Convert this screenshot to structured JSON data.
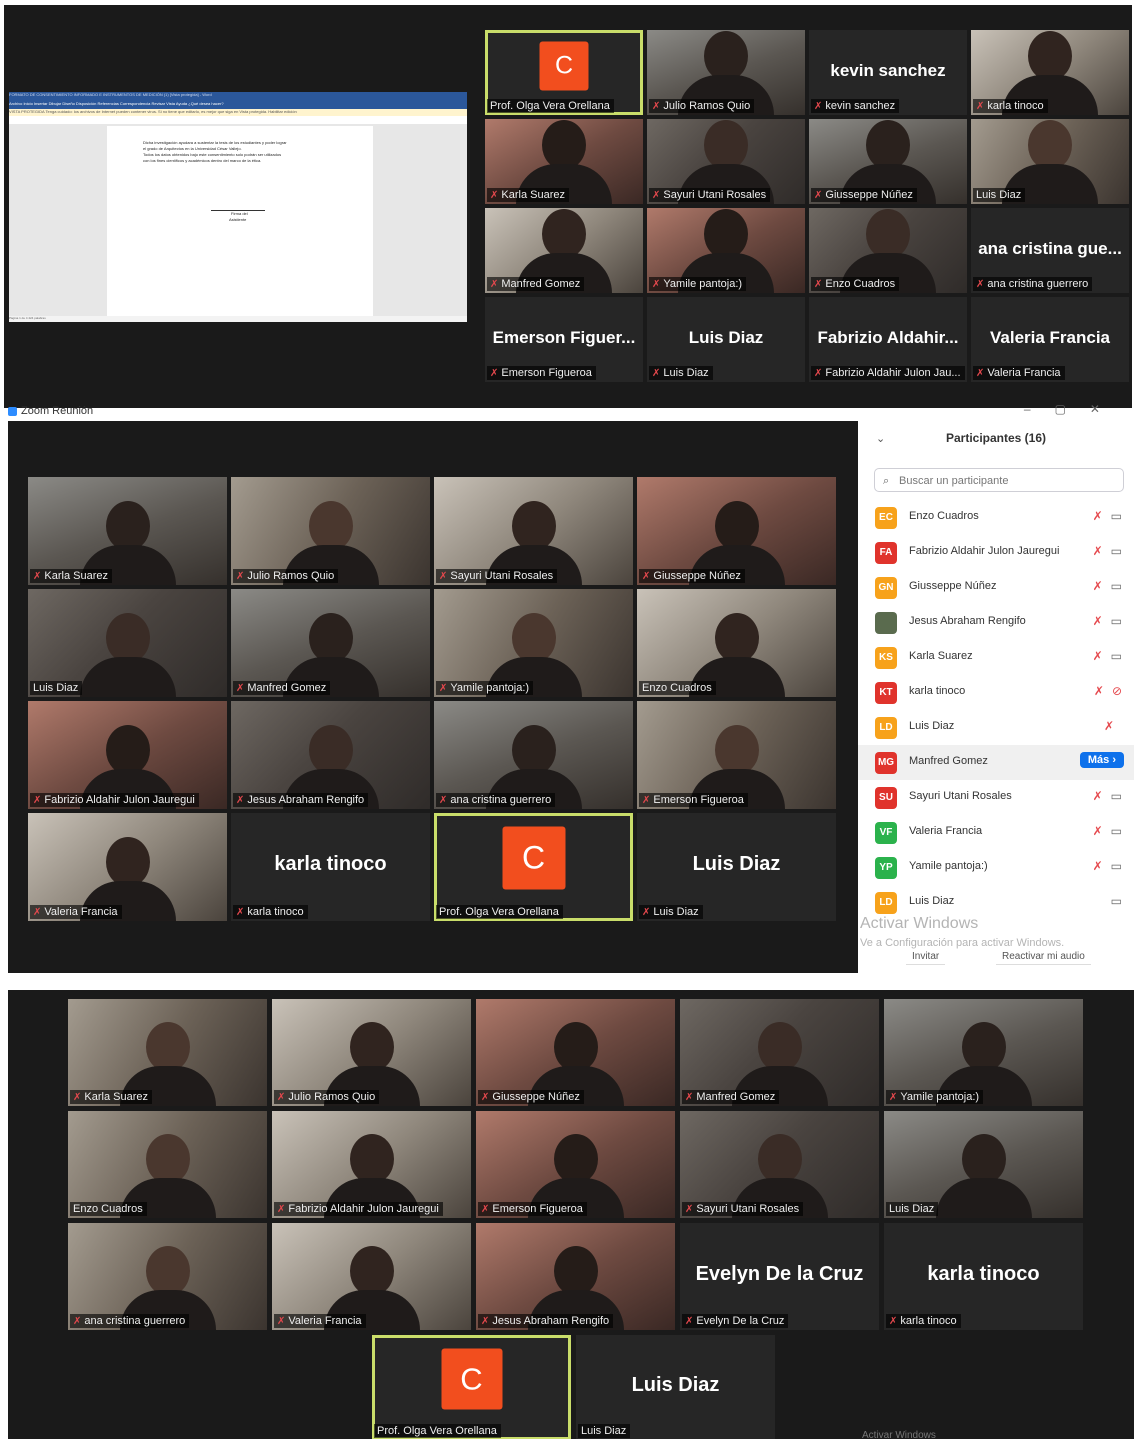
{
  "panel1": {
    "word_doc": {
      "title": "FORMATO DE CONSENTIMIENTO INFORMADO E INSTRUMENTOS DE MEDICIÓN (1) [Vista protegida] - Word",
      "ribbon_tabs": "Archivo  Inicio  Insertar  Dibujar  Diseño  Disposición  Referencias  Correspondencia  Revisar  Vista  Ayuda  ¿Qué desea hacer?",
      "protected_view": "VISTA PROTEGIDA   Tenga cuidado: los archivos de Internet pueden contener virus. Si no tiene que editarlo, es mejor que siga en Vista protegida.   Habilitar edición",
      "body_lines": [
        "Dicha investigación ayudara a sustentar la tesis de los estudiantes y poder lograr",
        "el grado de Arquitectos en la Universidad César Vallejo.",
        "Todos los datos obtenidos bajo este consentimiento solo podrán ser utilizados",
        "con los fines científicos y académicos dentro del marco de la ética."
      ],
      "signature_line1": "Firma del",
      "signature_line2": "Asistiente",
      "status": "Página 1 de 4    424 palabras"
    },
    "tiles": [
      {
        "type": "avatar",
        "letter": "C",
        "name": "Prof. Olga Vera Orellana",
        "muted": false,
        "active": true
      },
      {
        "type": "video",
        "name": "Julio Ramos Quio",
        "muted": true
      },
      {
        "type": "bigname",
        "big": "kevin sanchez",
        "name": "kevin sanchez",
        "muted": true
      },
      {
        "type": "video",
        "name": "karla tinoco",
        "muted": true
      },
      {
        "type": "video",
        "name": "Karla Suarez",
        "muted": true
      },
      {
        "type": "video",
        "name": "Sayuri Utani Rosales",
        "muted": true
      },
      {
        "type": "video",
        "name": "Giusseppe Núñez",
        "muted": true
      },
      {
        "type": "video",
        "name": "Luis Diaz",
        "muted": false
      },
      {
        "type": "video",
        "name": "Manfred Gomez",
        "muted": true
      },
      {
        "type": "video",
        "name": "Yamile pantoja:)",
        "muted": true
      },
      {
        "type": "video",
        "name": "Enzo Cuadros",
        "muted": true
      },
      {
        "type": "bigname",
        "big": "ana cristina gue...",
        "name": "ana cristina guerrero",
        "muted": true
      },
      {
        "type": "bigname",
        "big": "Emerson Figuer...",
        "name": "Emerson Figueroa",
        "muted": true
      },
      {
        "type": "bigname",
        "big": "Luis Diaz",
        "name": "Luis Diaz",
        "muted": true
      },
      {
        "type": "bigname",
        "big": "Fabrizio Aldahir...",
        "name": "Fabrizio Aldahir Julon Jau...",
        "muted": true
      },
      {
        "type": "bigname",
        "big": "Valeria Francia",
        "name": "Valeria Francia",
        "muted": true
      }
    ]
  },
  "panel2": {
    "window_title": "Zoom Reunión",
    "tiles": [
      {
        "type": "video",
        "name": "Karla Suarez",
        "muted": true
      },
      {
        "type": "video",
        "name": "Julio Ramos Quio",
        "muted": true
      },
      {
        "type": "video",
        "name": "Sayuri Utani Rosales",
        "muted": true
      },
      {
        "type": "video",
        "name": "Giusseppe Núñez",
        "muted": true
      },
      {
        "type": "video",
        "name": "Luis Diaz",
        "muted": false
      },
      {
        "type": "video",
        "name": "Manfred Gomez",
        "muted": true
      },
      {
        "type": "video",
        "name": "Yamile pantoja:)",
        "muted": true
      },
      {
        "type": "video",
        "name": "Enzo Cuadros",
        "muted": false
      },
      {
        "type": "video",
        "name": "Fabrizio Aldahir Julon Jauregui",
        "muted": true
      },
      {
        "type": "video",
        "name": "Jesus Abraham Rengifo",
        "muted": true
      },
      {
        "type": "video",
        "name": "ana cristina guerrero",
        "muted": true
      },
      {
        "type": "video",
        "name": "Emerson Figueroa",
        "muted": true
      },
      {
        "type": "video",
        "name": "Valeria Francia",
        "muted": true
      },
      {
        "type": "bigname",
        "big": "karla tinoco",
        "name": "karla tinoco",
        "muted": true
      },
      {
        "type": "avatar",
        "letter": "C",
        "name": "Prof. Olga Vera Orellana",
        "muted": false,
        "active": true
      },
      {
        "type": "bigname",
        "big": "Luis Diaz",
        "name": "Luis Diaz",
        "muted": true
      }
    ],
    "participants_panel": {
      "title": "Participantes (16)",
      "search_placeholder": "Buscar un participante",
      "list": [
        {
          "initials": "EC",
          "color": "#f7a21b",
          "name": "Enzo Cuadros",
          "icons": "mute-video"
        },
        {
          "initials": "FA",
          "color": "#e0332c",
          "name": "Fabrizio Aldahir Julon Jauregui",
          "icons": "mute-video"
        },
        {
          "initials": "GN",
          "color": "#f7a21b",
          "name": "Giusseppe Núñez",
          "icons": "mute-video"
        },
        {
          "initials": "",
          "color": "#5a6b4e",
          "name": "Jesus Abraham Rengifo",
          "icons": "mute-video"
        },
        {
          "initials": "KS",
          "color": "#f7a21b",
          "name": "Karla Suarez",
          "icons": "mute-video"
        },
        {
          "initials": "KT",
          "color": "#e0332c",
          "name": "karla tinoco",
          "icons": "mute-videooff"
        },
        {
          "initials": "LD",
          "color": "#f7a21b",
          "name": "Luis Diaz",
          "icons": "mute"
        },
        {
          "initials": "MG",
          "color": "#e0332c",
          "name": "Manfred Gomez",
          "icons": "mas"
        },
        {
          "initials": "SU",
          "color": "#e0332c",
          "name": "Sayuri Utani Rosales",
          "icons": "mute-video"
        },
        {
          "initials": "VF",
          "color": "#2bb24c",
          "name": "Valeria Francia",
          "icons": "mute-video"
        },
        {
          "initials": "YP",
          "color": "#2bb24c",
          "name": "Yamile pantoja:)",
          "icons": "mute-video"
        },
        {
          "initials": "LD",
          "color": "#f7a21b",
          "name": "Luis Diaz",
          "icons": "video"
        }
      ],
      "mas_label": "Más ›",
      "watermark_title": "Activar Windows",
      "watermark_sub": "Ve a Configuración para activar Windows.",
      "invite_label": "Invitar",
      "reactivate_label": "Reactivar mi audio"
    }
  },
  "panel3": {
    "tiles": [
      {
        "type": "video",
        "name": "Karla Suarez",
        "muted": true
      },
      {
        "type": "video",
        "name": "Julio Ramos Quio",
        "muted": true
      },
      {
        "type": "video",
        "name": "Giusseppe Núñez",
        "muted": true
      },
      {
        "type": "video",
        "name": "Manfred Gomez",
        "muted": true
      },
      {
        "type": "video",
        "name": "Yamile pantoja:)",
        "muted": true
      },
      {
        "type": "video",
        "name": "Enzo Cuadros",
        "muted": false
      },
      {
        "type": "video",
        "name": "Fabrizio Aldahir Julon Jauregui",
        "muted": true
      },
      {
        "type": "video",
        "name": "Emerson Figueroa",
        "muted": true
      },
      {
        "type": "video",
        "name": "Sayuri Utani Rosales",
        "muted": true
      },
      {
        "type": "video",
        "name": "Luis Diaz",
        "muted": false
      },
      {
        "type": "video",
        "name": "ana cristina guerrero",
        "muted": true
      },
      {
        "type": "video",
        "name": "Valeria Francia",
        "muted": true
      },
      {
        "type": "video",
        "name": "Jesus Abraham Rengifo",
        "muted": true
      },
      {
        "type": "bigname",
        "big": "Evelyn De la Cruz",
        "name": "Evelyn De la Cruz",
        "muted": true
      },
      {
        "type": "bigname",
        "big": "karla tinoco",
        "name": "karla tinoco",
        "muted": true
      },
      {
        "type": "avatar",
        "letter": "C",
        "name": "Prof. Olga Vera Orellana",
        "muted": false,
        "active": true
      },
      {
        "type": "bigname",
        "big": "Luis Diaz",
        "name": "Luis Diaz",
        "muted": false
      }
    ],
    "watermark_partial": "Activar Windows"
  }
}
